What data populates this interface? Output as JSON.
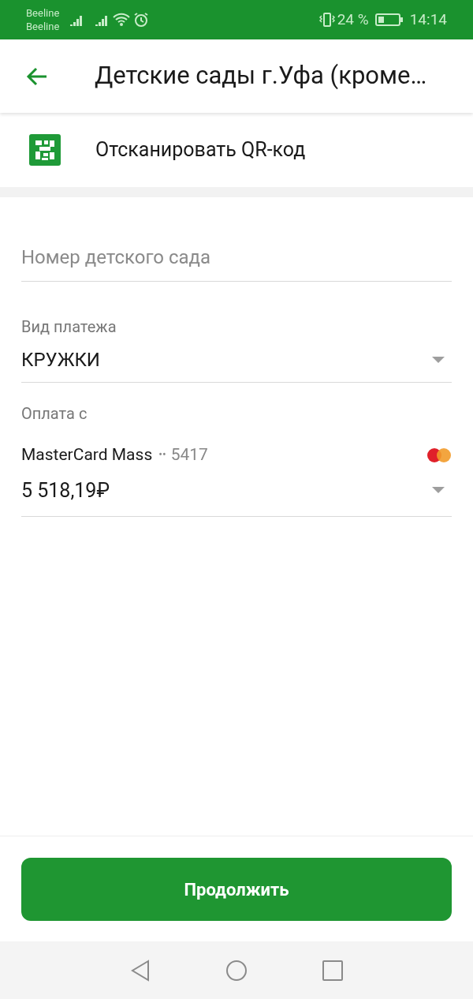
{
  "status_bar": {
    "carriers": [
      "Beeline",
      "Beeline"
    ],
    "battery": "24 %",
    "time": "14:14"
  },
  "header": {
    "title": "Детские сады г.Уфа (кроме…"
  },
  "qr_action": {
    "label": "Отсканировать QR-код"
  },
  "form": {
    "kindergarten_number": {
      "placeholder": "Номер детского сада"
    },
    "payment_type": {
      "label": "Вид платежа",
      "value": "КРУЖКИ"
    },
    "pay_from": {
      "label": "Оплата с",
      "card_name": "MasterCard Mass",
      "card_dots": "••",
      "card_last4": "5417",
      "balance": "5 518,19₽"
    }
  },
  "continue_button": {
    "label": "Продолжить"
  }
}
